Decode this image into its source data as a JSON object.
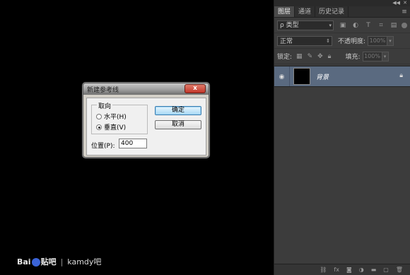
{
  "panel": {
    "tabs": [
      {
        "label": "图层"
      },
      {
        "label": "通道"
      },
      {
        "label": "历史记录"
      }
    ],
    "filter": {
      "kind_label": "ρ 类型"
    },
    "blend": {
      "mode": "正常",
      "opacity_label": "不透明度:",
      "opacity_value": "100%"
    },
    "lock": {
      "label": "锁定:",
      "fill_label": "填充:",
      "fill_value": "100%"
    },
    "layers": [
      {
        "name": "背景"
      }
    ],
    "bottom_icons": [
      "link-icon",
      "fx-icon",
      "mask-icon",
      "adjustment-icon",
      "group-icon",
      "new-layer-icon",
      "delete-icon"
    ]
  },
  "dialog": {
    "title": "新建参考线",
    "close_glyph": "x",
    "orientation_label": "取向",
    "horizontal_label": "水平(H)",
    "vertical_label": "垂直(V)",
    "selected": "vertical",
    "ok_label": "确定",
    "cancel_label": "取消",
    "position_label": "位置(P):",
    "position_value": "400"
  },
  "watermark": {
    "brand_left": "Bai",
    "brand_right": "贴吧",
    "separator": "|",
    "user": "kamdy吧"
  }
}
